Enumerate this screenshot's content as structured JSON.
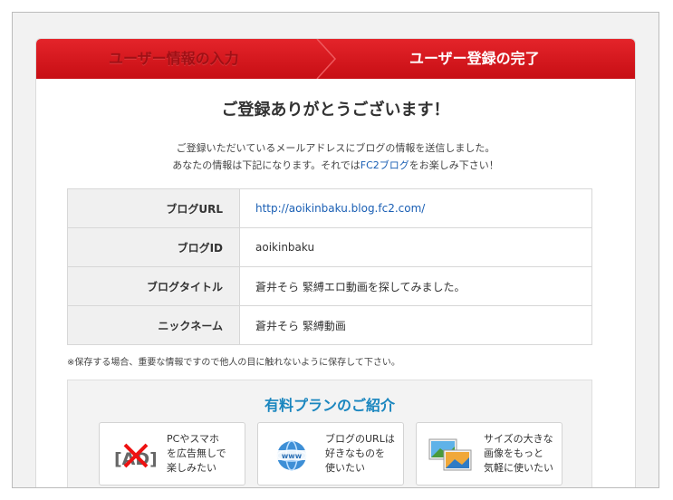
{
  "steps": {
    "step1": "ユーザー情報の入力",
    "step2": "ユーザー登録の完了"
  },
  "headline": "ご登録ありがとうございます！",
  "message": {
    "line1": "ご登録いただいているメールアドレスにブログの情報を送信しました。",
    "line2_before": "あなたの情報は下記になります。それでは",
    "line2_link": "FC2ブログ",
    "line2_after": "をお楽しみ下さい！"
  },
  "info": {
    "rows": [
      {
        "label": "ブログURL",
        "value": "http://aoikinbaku.blog.fc2.com/"
      },
      {
        "label": "ブログID",
        "value": "aoikinbaku"
      },
      {
        "label": "ブログタイトル",
        "value": "蒼井そら 緊縛エロ動画を探してみました。"
      },
      {
        "label": "ニックネーム",
        "value": "蒼井そら 緊縛動画"
      }
    ]
  },
  "note": "※保存する場合、重要な情報ですので他人の目に触れないように保存して下さい。",
  "plan": {
    "title": "有料プランのご紹介",
    "cards": [
      {
        "icon": "no-ads-icon",
        "text": "PCやスマホ\nを広告無しで\n楽しみたい"
      },
      {
        "icon": "globe-www-icon",
        "text": "ブログのURLは\n好きなものを\n使いたい"
      },
      {
        "icon": "images-icon",
        "text": "サイズの大きな\n画像をもっと\n気軽に使いたい"
      }
    ]
  },
  "colors": {
    "bar_red": "#d5161c",
    "link_blue": "#1a5fb4",
    "plan_title": "#1a86bf"
  }
}
